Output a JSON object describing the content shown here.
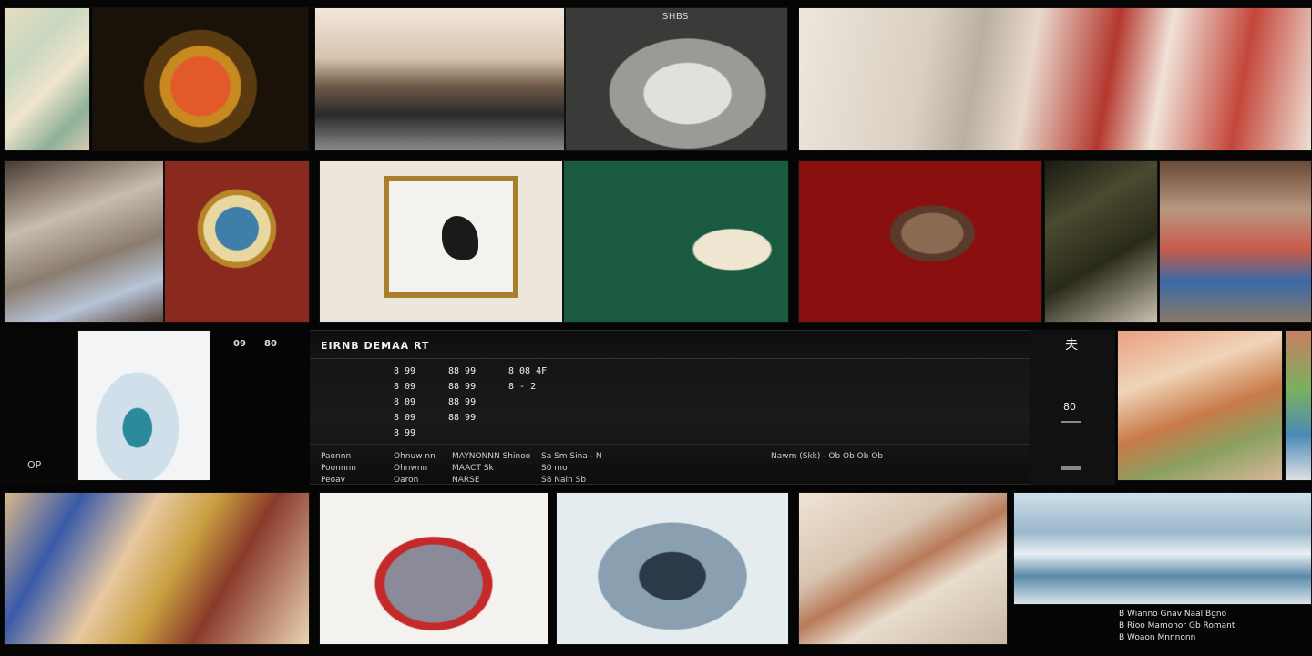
{
  "panel": {
    "title": "EIRNB DEMAA RT",
    "col1": [
      "8 99",
      "8 09",
      "8 09",
      "8 09",
      "8 99"
    ],
    "col2": [
      "88 99",
      "88 99",
      "88 99",
      "88 99"
    ],
    "col3": [
      "8 08 4F",
      "8 - 2",
      "",
      ""
    ],
    "foot1": [
      "Paonnn",
      "Poonnnn",
      "Peoav"
    ],
    "foot2": [
      "Ohnuw nn",
      "Ohnwnn",
      "Oaron"
    ],
    "foot3": [
      "MAYNONNN Shinoo",
      "MAACT Sk",
      "NARSE"
    ],
    "foot4": [
      "Sa Sm Sina - N",
      "S0 mo",
      "S8 Nain Sb"
    ],
    "foot5": [
      "Nawm (Skk) - Ob Ob Ob Ob"
    ]
  },
  "left": {
    "label": "OP",
    "num1": "09",
    "num2": "80"
  },
  "side": {
    "glyph": "夫",
    "num": "80"
  },
  "bottom_caption": [
    "B Wianno Gnav Naal Bgno",
    "B Rioo Mamonor Gb Romant",
    "B Woaon Mnnnonn"
  ],
  "top_caption": "SHBS"
}
